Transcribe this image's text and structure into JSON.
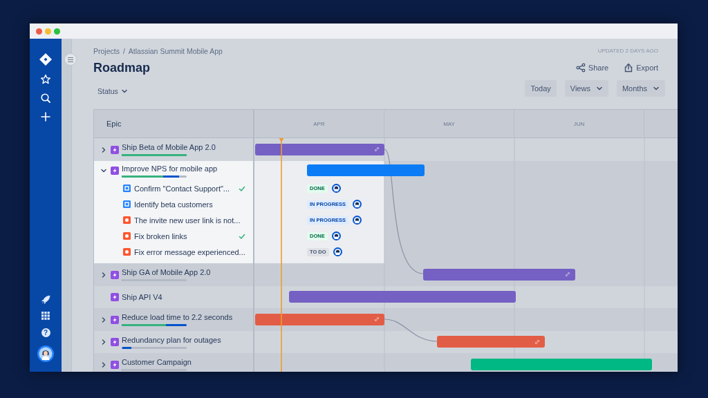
{
  "sidebar": {
    "help_label": "?"
  },
  "breadcrumb": {
    "items": [
      "Projects",
      "Atlassian Summit Mobile App"
    ],
    "separator": "/"
  },
  "title": "Roadmap",
  "filters": [
    {
      "label": "Status"
    }
  ],
  "updated": "UPDATED 2 DAYS AGO",
  "actions": [
    {
      "label": "Share",
      "kind": "share"
    },
    {
      "label": "Export",
      "kind": "export"
    }
  ],
  "view_controls": [
    {
      "label": "Today",
      "kind": "button"
    },
    {
      "label": "Views",
      "kind": "dropdown"
    },
    {
      "label": "Months",
      "kind": "dropdown"
    }
  ],
  "table": {
    "column": "Epic",
    "months": [
      "APR",
      "MAY",
      "JUN"
    ],
    "epics": [
      {
        "title": "Ship Beta of Mobile App 2.0",
        "has_children": true,
        "expanded": false,
        "progress": {
          "done": {
            "level": 1
          },
          "started": {
            "level": 1
          }
        },
        "bar": {
          "color": "#7560c4",
          "linked": true
        }
      },
      {
        "title": "Improve NPS for mobile app",
        "has_children": true,
        "expanded": true,
        "progress": {
          "done": {
            "level": 0.64
          },
          "started": {
            "level": 0.88
          }
        },
        "bar": {
          "color": "#0b7cf5",
          "linked": false
        },
        "children": [
          {
            "title": "Confirm \"Contact Support\"...",
            "kind": "task",
            "checked": true,
            "status": {
              "label": "DONE",
              "kind": "done"
            }
          },
          {
            "title": "Identify beta customers",
            "kind": "task",
            "checked": false,
            "status": {
              "label": "IN PROGRESS",
              "kind": "in_progress"
            }
          },
          {
            "title": "The invite new user link is not...",
            "kind": "bug",
            "checked": false,
            "status": {
              "label": "IN PROGRESS",
              "kind": "in_progress"
            }
          },
          {
            "title": "Fix broken links",
            "kind": "bug",
            "checked": true,
            "status": {
              "label": "DONE",
              "kind": "done"
            }
          },
          {
            "title": "Fix error message experienced...",
            "kind": "bug",
            "checked": false,
            "status": {
              "label": "TO DO",
              "kind": "todo"
            }
          }
        ]
      },
      {
        "title": "Ship GA of Mobile App 2.0",
        "has_children": true,
        "expanded": false,
        "progress": {
          "done": {
            "level": 0
          },
          "started": {
            "level": 0
          }
        },
        "bar": {
          "color": "#7560c4",
          "linked": true
        }
      },
      {
        "title": "Ship API V4",
        "has_children": false,
        "expanded": false,
        "bar": {
          "color": "#7560c4",
          "linked": false
        }
      },
      {
        "title": "Reduce load time to 2.2 seconds",
        "has_children": true,
        "expanded": false,
        "progress": {
          "done": {
            "level": 0.68
          },
          "started": {
            "level": 1
          }
        },
        "bar": {
          "color": "#e25d45",
          "linked": true
        }
      },
      {
        "title": "Redundancy plan for outages",
        "has_children": true,
        "expanded": false,
        "progress": {
          "done": {
            "level": 0
          },
          "started": {
            "level": 0.15
          }
        },
        "bar": {
          "color": "#e25d45",
          "linked": true
        }
      },
      {
        "title": "Customer Campaign",
        "has_children": true,
        "expanded": false,
        "progress": {
          "done": {
            "level": 0
          },
          "started": {
            "level": 0
          }
        },
        "bar": {
          "color": "#00b884",
          "linked": false
        }
      }
    ]
  }
}
